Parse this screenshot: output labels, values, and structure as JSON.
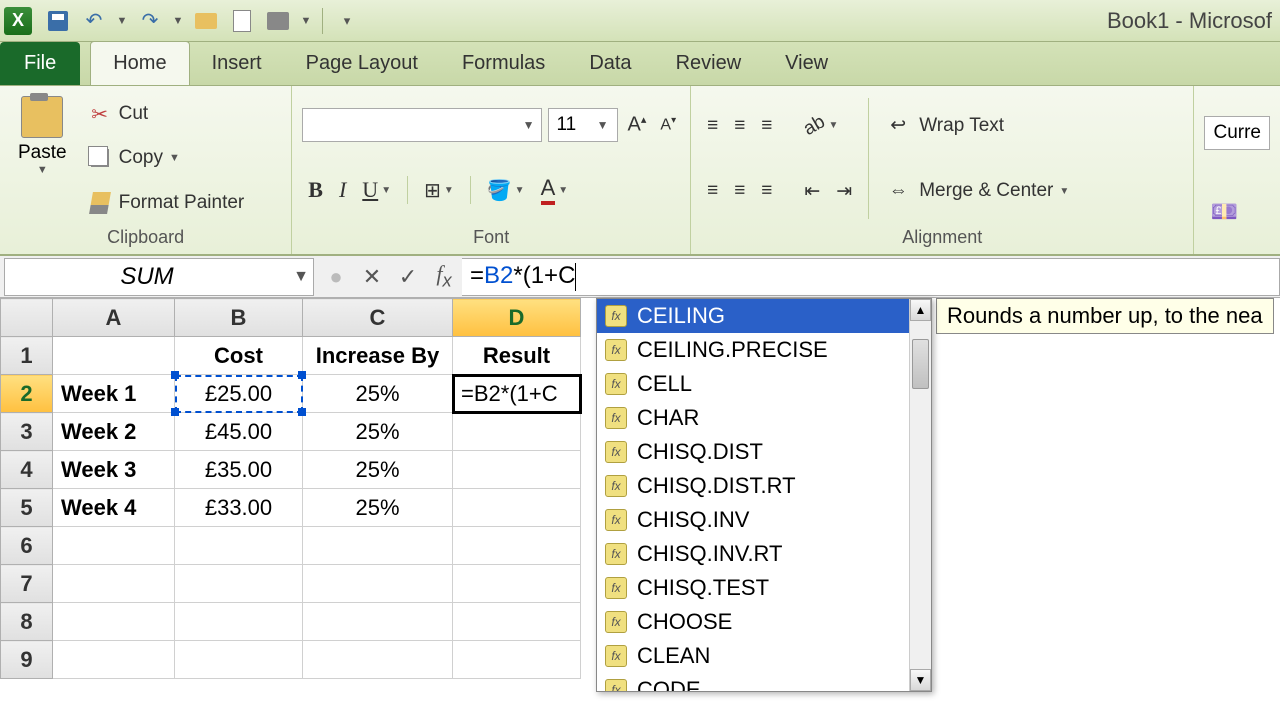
{
  "app_title": "Book1 - Microsof",
  "tabs": {
    "file": "File",
    "items": [
      "Home",
      "Insert",
      "Page Layout",
      "Formulas",
      "Data",
      "Review",
      "View"
    ],
    "active": "Home"
  },
  "ribbon": {
    "clipboard": {
      "label": "Clipboard",
      "paste": "Paste",
      "cut": "Cut",
      "copy": "Copy",
      "format_painter": "Format Painter"
    },
    "font": {
      "label": "Font",
      "size": "11"
    },
    "alignment": {
      "label": "Alignment",
      "wrap": "Wrap Text",
      "merge": "Merge & Center"
    },
    "number": {
      "format": "Curre"
    }
  },
  "namebox": "SUM",
  "formula": {
    "prefix": "=",
    "ref": "B2",
    "mid": "*(1+",
    "typed": "C"
  },
  "columns": [
    "A",
    "B",
    "C",
    "D"
  ],
  "rows": [
    "1",
    "2",
    "3",
    "4",
    "5",
    "6",
    "7",
    "8",
    "9"
  ],
  "sheet": {
    "headers": {
      "B1": "Cost",
      "C1": "Increase By",
      "D1": "Result"
    },
    "data": [
      {
        "A": "Week 1",
        "B": "£25.00",
        "C": "25%"
      },
      {
        "A": "Week 2",
        "B": "£45.00",
        "C": "25%"
      },
      {
        "A": "Week 3",
        "B": "£35.00",
        "C": "25%"
      },
      {
        "A": "Week 4",
        "B": "£33.00",
        "C": "25%"
      }
    ],
    "editing_cell_display": "=B2*(1+C"
  },
  "autocomplete": {
    "items": [
      "CEILING",
      "CEILING.PRECISE",
      "CELL",
      "CHAR",
      "CHISQ.DIST",
      "CHISQ.DIST.RT",
      "CHISQ.INV",
      "CHISQ.INV.RT",
      "CHISQ.TEST",
      "CHOOSE",
      "CLEAN",
      "CODE"
    ],
    "selected": "CEILING",
    "tooltip": "Rounds a number up, to the nea"
  }
}
